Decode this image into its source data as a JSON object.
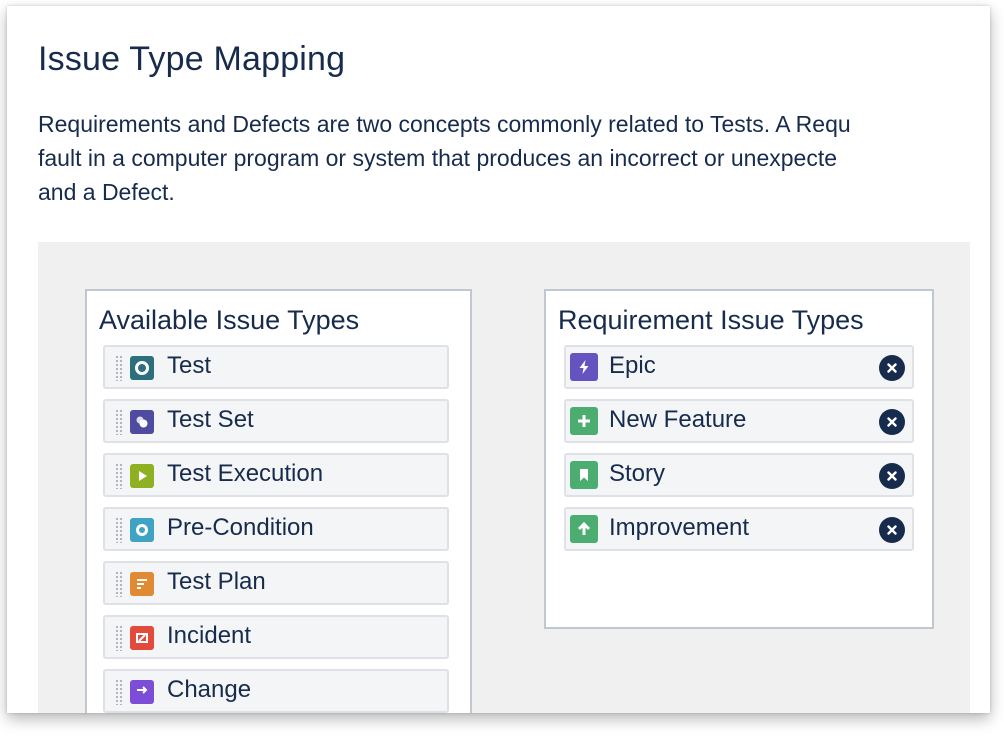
{
  "page": {
    "title": "Issue Type Mapping",
    "description_lines": [
      "Requirements and Defects are two concepts commonly related to Tests. A Requ",
      "fault in a computer program or system that produces an incorrect or unexpecte",
      "and a Defect."
    ]
  },
  "available": {
    "title": "Available Issue Types",
    "items": [
      {
        "label": "Test",
        "icon": "test-icon",
        "color": "#2e6f7e"
      },
      {
        "label": "Test Set",
        "icon": "test-set-icon",
        "color": "#4f4ba0"
      },
      {
        "label": "Test Execution",
        "icon": "test-execution-icon",
        "color": "#8eb021"
      },
      {
        "label": "Pre-Condition",
        "icon": "pre-condition-icon",
        "color": "#3fa3c3"
      },
      {
        "label": "Test Plan",
        "icon": "test-plan-icon",
        "color": "#e08b33"
      },
      {
        "label": "Incident",
        "icon": "incident-icon",
        "color": "#e24b3b"
      },
      {
        "label": "Change",
        "icon": "change-icon",
        "color": "#7c4dd6"
      }
    ]
  },
  "requirement": {
    "title": "Requirement Issue Types",
    "items": [
      {
        "label": "Epic",
        "icon": "epic-icon",
        "color": "#6554c0"
      },
      {
        "label": "New Feature",
        "icon": "new-feature-icon",
        "color": "#4bae70"
      },
      {
        "label": "Story",
        "icon": "story-icon",
        "color": "#4bae70"
      },
      {
        "label": "Improvement",
        "icon": "improvement-icon",
        "color": "#4bae70"
      }
    ]
  }
}
